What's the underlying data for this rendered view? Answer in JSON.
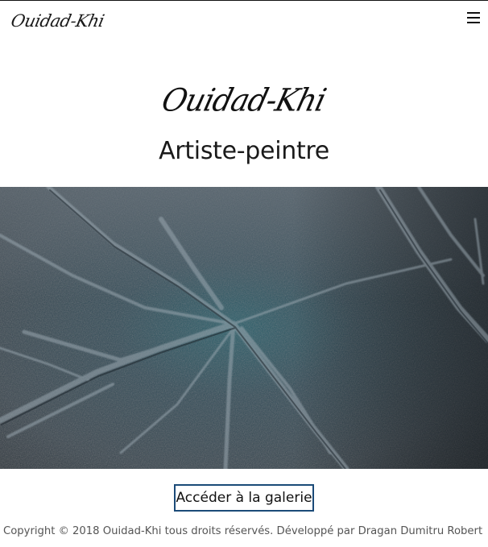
{
  "header": {
    "logo_text": "Ouidad-Khi",
    "menu_icon": "hamburger-menu-icon"
  },
  "hero": {
    "logo_text": "Ouidad-Khi",
    "subtitle": "Artiste-peintre"
  },
  "painting": {
    "description_colors": {
      "base": "#2f3f4a",
      "teal_glow": "#1f5f6b",
      "light": "#8a98a2",
      "dark": "#1c252c"
    }
  },
  "cta": {
    "label": "Accéder à la galerie",
    "border_color": "#1b4b78"
  },
  "footer": {
    "text": "Copyright © 2018 Ouidad-Khi tous droits réservés. Développé par Dragan Dumitru Robert"
  }
}
